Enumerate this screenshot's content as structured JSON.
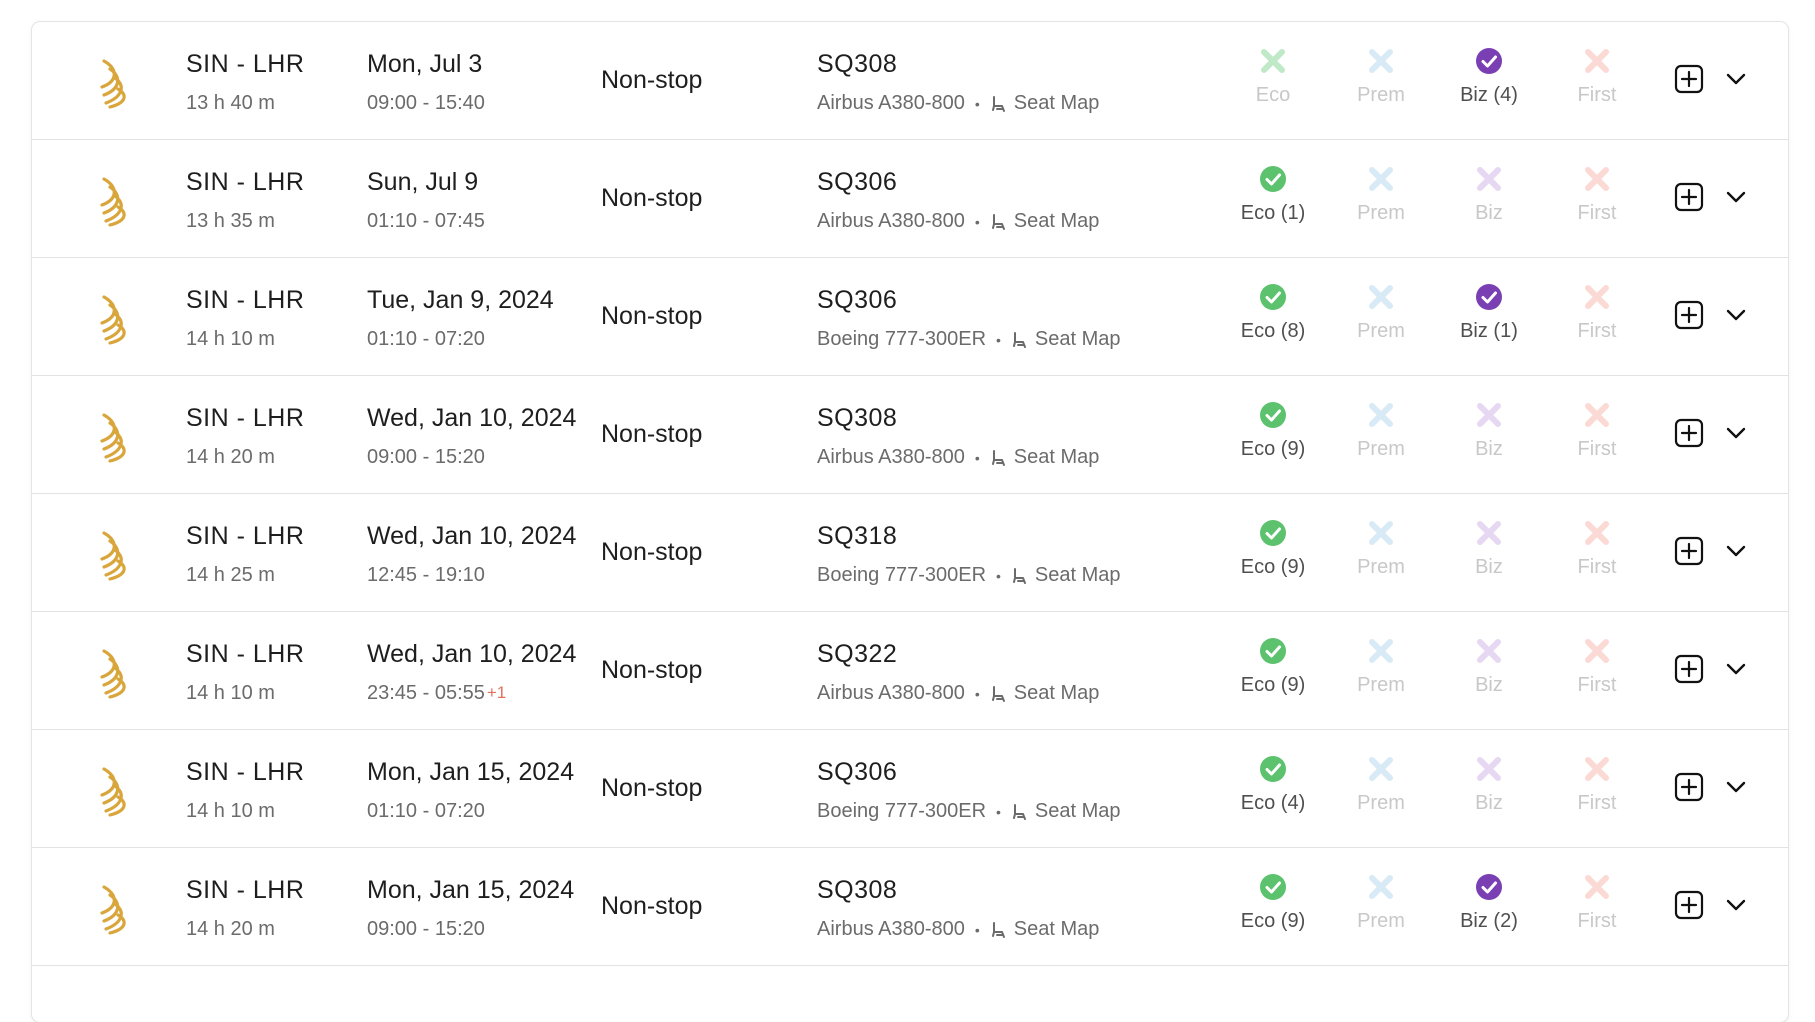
{
  "colors": {
    "eco_available": "#5cc26e",
    "eco_unavailable": "#bfe9c7",
    "prem_unavailable": "#d7eaf6",
    "biz_available": "#7b3fb4",
    "biz_unavailable": "#e6d8f2",
    "first_unavailable": "#fbd9d4",
    "airline_logo": "#d9a63c"
  },
  "icons": {
    "airline_logo": "singapore-airlines-logo",
    "available": "check-circle-icon",
    "unavailable": "x-icon",
    "seat": "seat-icon",
    "add": "plus-square-icon",
    "expand": "chevron-down-icon"
  },
  "flights": [
    {
      "route": "SIN - LHR",
      "duration": "13 h 40 m",
      "date": "Mon, Jul 3",
      "times": "09:00 - 15:40",
      "plus_day": "",
      "stops": "Non-stop",
      "flight": "SQ308",
      "aircraft": "Airbus A380-800",
      "seat_map": "Seat Map",
      "eco": {
        "available": false,
        "label": "Eco"
      },
      "prem": {
        "available": false,
        "label": "Prem"
      },
      "biz": {
        "available": true,
        "label": "Biz (4)"
      },
      "first": {
        "available": false,
        "label": "First"
      }
    },
    {
      "route": "SIN - LHR",
      "duration": "13 h 35 m",
      "date": "Sun, Jul 9",
      "times": "01:10 - 07:45",
      "plus_day": "",
      "stops": "Non-stop",
      "flight": "SQ306",
      "aircraft": "Airbus A380-800",
      "seat_map": "Seat Map",
      "eco": {
        "available": true,
        "label": "Eco (1)"
      },
      "prem": {
        "available": false,
        "label": "Prem"
      },
      "biz": {
        "available": false,
        "label": "Biz"
      },
      "first": {
        "available": false,
        "label": "First"
      }
    },
    {
      "route": "SIN - LHR",
      "duration": "14 h 10 m",
      "date": "Tue, Jan 9, 2024",
      "times": "01:10 - 07:20",
      "plus_day": "",
      "stops": "Non-stop",
      "flight": "SQ306",
      "aircraft": "Boeing 777-300ER",
      "seat_map": "Seat Map",
      "eco": {
        "available": true,
        "label": "Eco (8)"
      },
      "prem": {
        "available": false,
        "label": "Prem"
      },
      "biz": {
        "available": true,
        "label": "Biz (1)"
      },
      "first": {
        "available": false,
        "label": "First"
      }
    },
    {
      "route": "SIN - LHR",
      "duration": "14 h 20 m",
      "date": "Wed, Jan 10, 2024",
      "times": "09:00 - 15:20",
      "plus_day": "",
      "stops": "Non-stop",
      "flight": "SQ308",
      "aircraft": "Airbus A380-800",
      "seat_map": "Seat Map",
      "eco": {
        "available": true,
        "label": "Eco (9)"
      },
      "prem": {
        "available": false,
        "label": "Prem"
      },
      "biz": {
        "available": false,
        "label": "Biz"
      },
      "first": {
        "available": false,
        "label": "First"
      }
    },
    {
      "route": "SIN - LHR",
      "duration": "14 h 25 m",
      "date": "Wed, Jan 10, 2024",
      "times": "12:45 - 19:10",
      "plus_day": "",
      "stops": "Non-stop",
      "flight": "SQ318",
      "aircraft": "Boeing 777-300ER",
      "seat_map": "Seat Map",
      "eco": {
        "available": true,
        "label": "Eco (9)"
      },
      "prem": {
        "available": false,
        "label": "Prem"
      },
      "biz": {
        "available": false,
        "label": "Biz"
      },
      "first": {
        "available": false,
        "label": "First"
      }
    },
    {
      "route": "SIN - LHR",
      "duration": "14 h 10 m",
      "date": "Wed, Jan 10, 2024",
      "times": "23:45 - 05:55",
      "plus_day": "+1",
      "stops": "Non-stop",
      "flight": "SQ322",
      "aircraft": "Airbus A380-800",
      "seat_map": "Seat Map",
      "eco": {
        "available": true,
        "label": "Eco (9)"
      },
      "prem": {
        "available": false,
        "label": "Prem"
      },
      "biz": {
        "available": false,
        "label": "Biz"
      },
      "first": {
        "available": false,
        "label": "First"
      }
    },
    {
      "route": "SIN - LHR",
      "duration": "14 h 10 m",
      "date": "Mon, Jan 15, 2024",
      "times": "01:10 - 07:20",
      "plus_day": "",
      "stops": "Non-stop",
      "flight": "SQ306",
      "aircraft": "Boeing 777-300ER",
      "seat_map": "Seat Map",
      "eco": {
        "available": true,
        "label": "Eco (4)"
      },
      "prem": {
        "available": false,
        "label": "Prem"
      },
      "biz": {
        "available": false,
        "label": "Biz"
      },
      "first": {
        "available": false,
        "label": "First"
      }
    },
    {
      "route": "SIN - LHR",
      "duration": "14 h 20 m",
      "date": "Mon, Jan 15, 2024",
      "times": "09:00 - 15:20",
      "plus_day": "",
      "stops": "Non-stop",
      "flight": "SQ308",
      "aircraft": "Airbus A380-800",
      "seat_map": "Seat Map",
      "eco": {
        "available": true,
        "label": "Eco (9)"
      },
      "prem": {
        "available": false,
        "label": "Prem"
      },
      "biz": {
        "available": true,
        "label": "Biz (2)"
      },
      "first": {
        "available": false,
        "label": "First"
      }
    }
  ]
}
